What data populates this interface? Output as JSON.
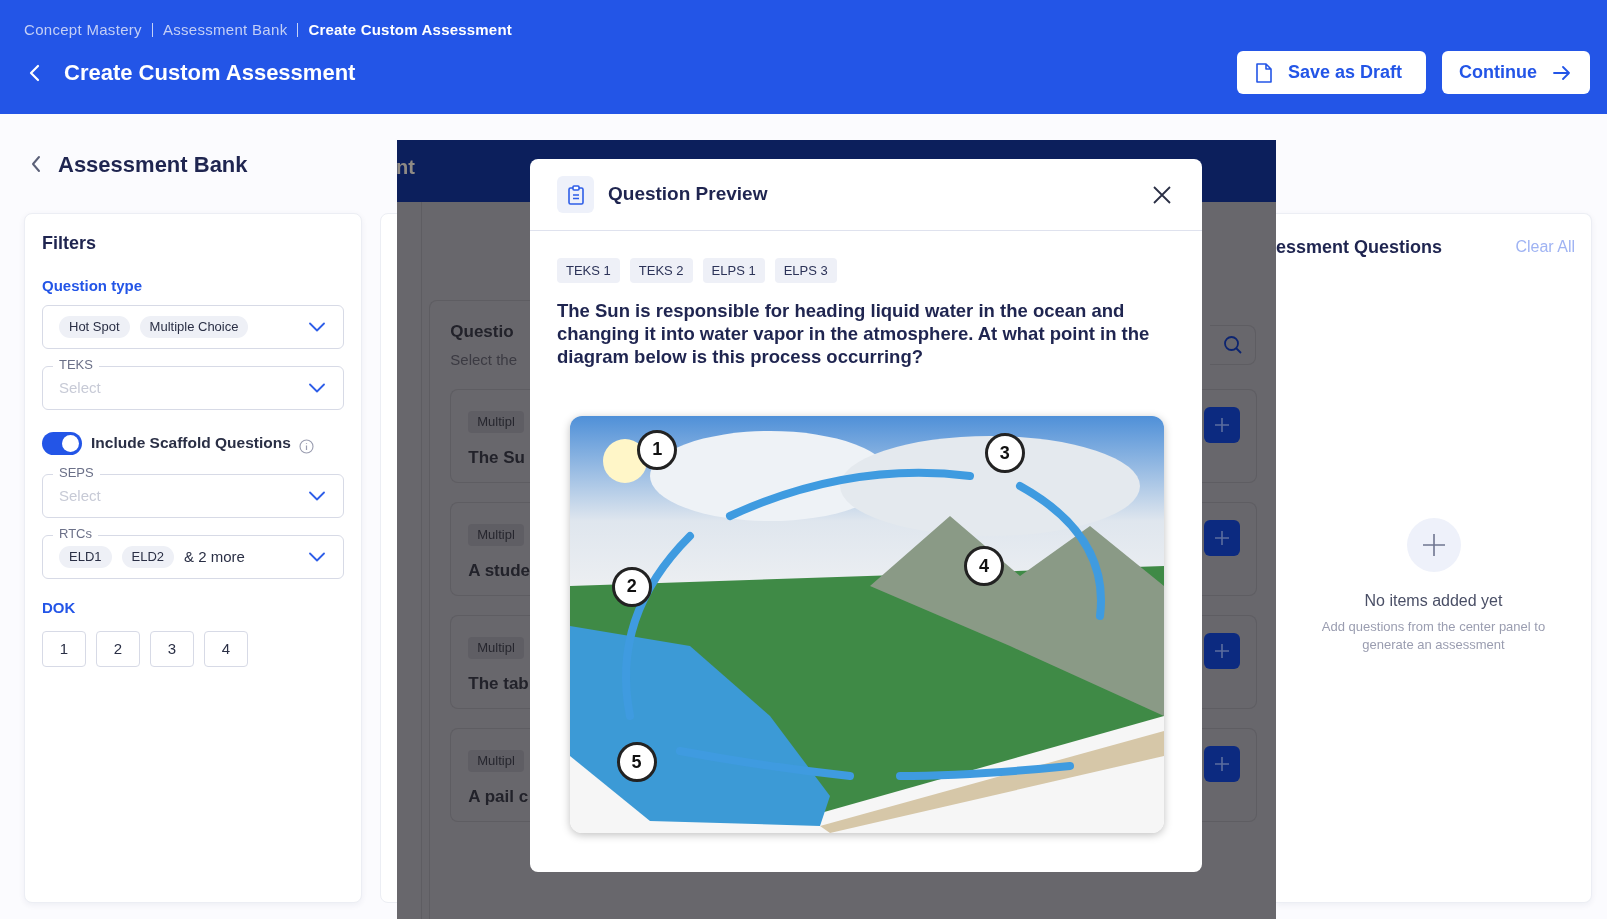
{
  "header": {
    "breadcrumbs": [
      {
        "label": "Concept Mastery",
        "current": false
      },
      {
        "label": "Assessment Bank",
        "current": false
      },
      {
        "label": "Create Custom Assessment",
        "current": true
      }
    ],
    "title": "Create Custom Assessment",
    "buttons": [
      {
        "label": "Save as Draft",
        "kind": "draft"
      },
      {
        "label": "Continue",
        "kind": "continue"
      }
    ]
  },
  "sidebar": {
    "title": "Assessment Bank",
    "filters_title": "Filters",
    "filters": [
      {
        "kind": "heading",
        "text": "Question type"
      },
      {
        "kind": "select",
        "chips": [
          "Hot Spot",
          "Multiple Choice"
        ]
      },
      {
        "kind": "select",
        "label": "TEKS",
        "placeholder": "Select"
      },
      {
        "kind": "toggle",
        "label": "Include Scaffold Questions",
        "on": true
      },
      {
        "kind": "select",
        "label": "SEPS",
        "placeholder": "Select"
      },
      {
        "kind": "select",
        "label": "RTCs",
        "chips": [
          "ELD1",
          "ELD2"
        ],
        "more": "& 2 more"
      },
      {
        "kind": "heading",
        "text": "DOK"
      },
      {
        "kind": "options",
        "options": [
          "1",
          "2",
          "3",
          "4"
        ]
      }
    ]
  },
  "center_panel": {
    "title_fragment": "nt",
    "list_title": "Questio",
    "list_subtitle": "Select the",
    "cards": [
      {
        "tag": "Multipl",
        "text": "The Su"
      },
      {
        "tag": "Multipl",
        "text": "A stude"
      },
      {
        "tag": "Multipl",
        "text": "The tab"
      },
      {
        "tag": "Multipl",
        "text": "A pail c"
      }
    ]
  },
  "modal": {
    "title": "Question Preview",
    "tags": [
      "TEKS 1",
      "TEKS 2",
      "ELPS 1",
      "ELPS 3"
    ],
    "question": "The Sun is responsible for heading liquid water in the ocean and changing it into water vapor in the atmosphere. At what point in the diagram below is this process occurring?",
    "diagram_labels": [
      "1",
      "2",
      "3",
      "4",
      "5"
    ]
  },
  "right_panel": {
    "title": "essment Questions",
    "clear": "Clear All",
    "empty_title": "No items added yet",
    "empty_text": "Add questions from the center panel to generate an assessment"
  }
}
